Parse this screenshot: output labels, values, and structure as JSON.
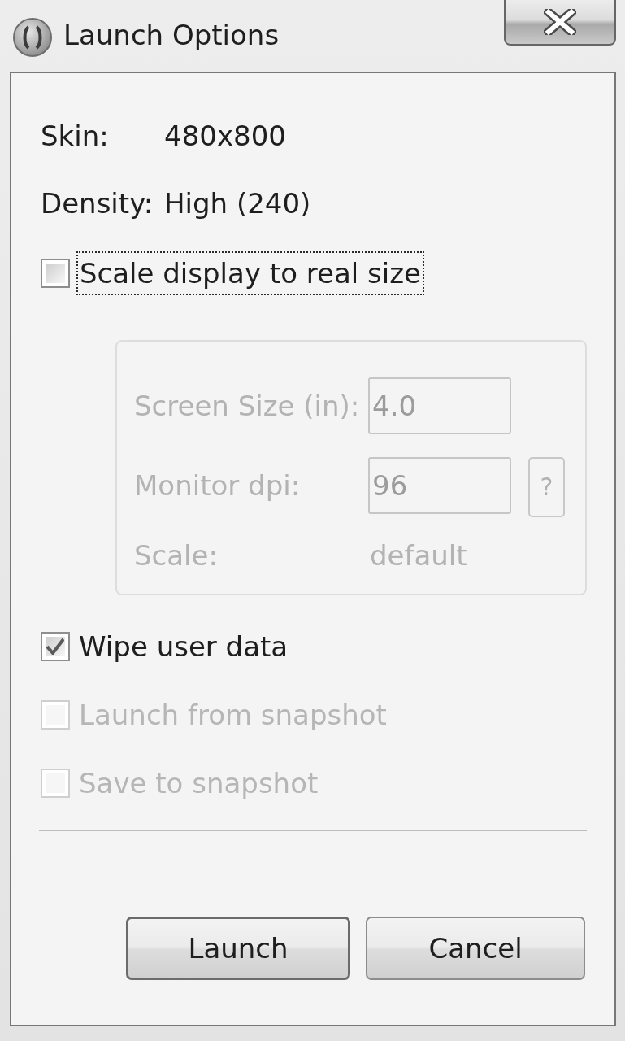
{
  "window": {
    "title": "Launch Options"
  },
  "info": [
    {
      "label": "Skin:",
      "value": "480x800"
    },
    {
      "label": "Density:",
      "value": "High (240)"
    }
  ],
  "scale_option": {
    "label": "Scale display to real size",
    "checked": false,
    "focused": true
  },
  "scale_group": {
    "disabled": true,
    "fields": [
      {
        "kind": "input",
        "label": "Screen Size (in):",
        "value": "4.0"
      },
      {
        "kind": "input",
        "label": "Monitor dpi:",
        "value": "96",
        "help": "?"
      },
      {
        "kind": "text",
        "label": "Scale:",
        "value": "default"
      }
    ]
  },
  "options": [
    {
      "label": "Wipe user data",
      "checked": true,
      "disabled": false
    },
    {
      "label": "Launch from snapshot",
      "checked": false,
      "disabled": true
    },
    {
      "label": "Save to snapshot",
      "checked": false,
      "disabled": true
    }
  ],
  "buttons": [
    {
      "label": "Launch",
      "default": true
    },
    {
      "label": "Cancel",
      "default": false
    }
  ]
}
